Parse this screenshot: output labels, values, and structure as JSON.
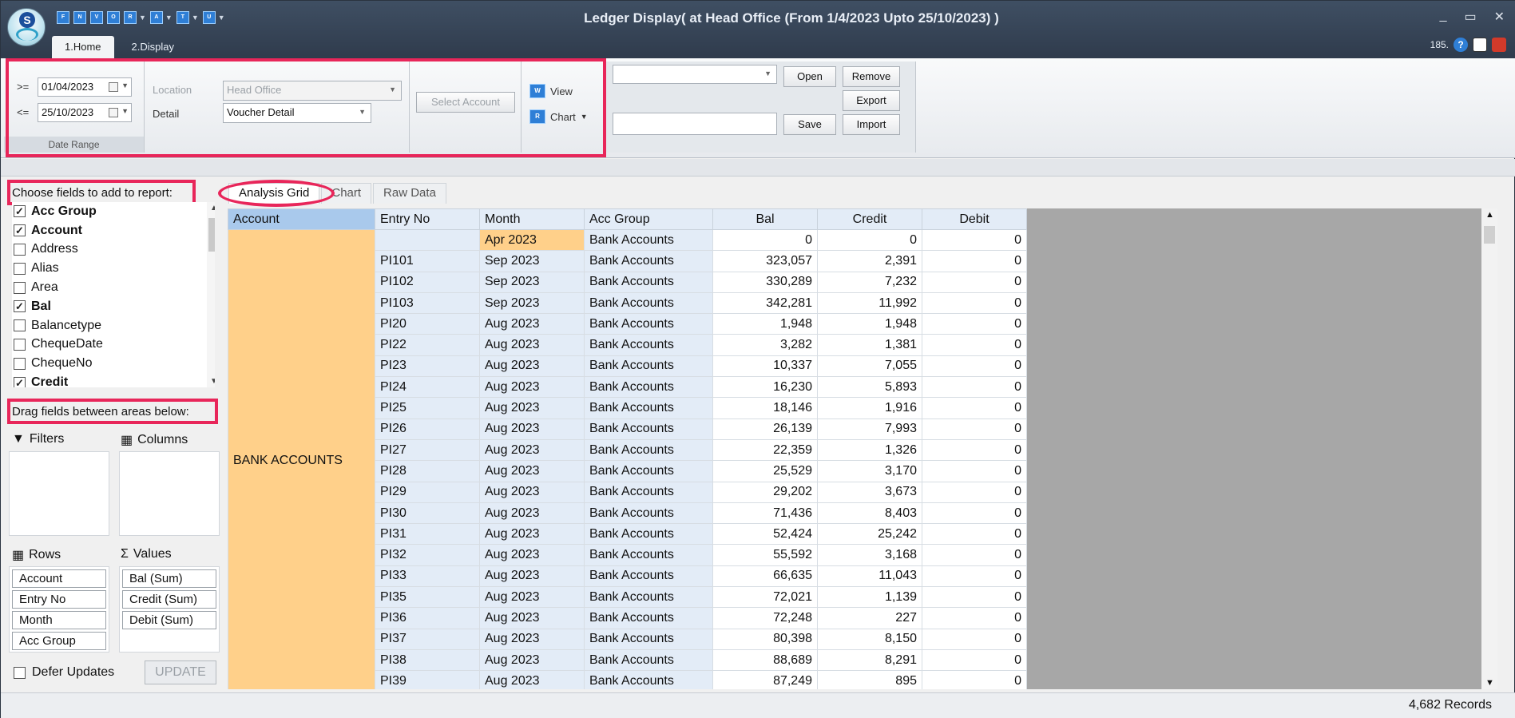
{
  "window": {
    "title": "Ledger Display( at Head Office  (From 1/4/2023 Upto 25/10/2023) )",
    "controls": [
      "_",
      "▭",
      "✕"
    ]
  },
  "quick_access": [
    "F",
    "N",
    "V",
    "O",
    "R",
    "A",
    "T",
    "U"
  ],
  "ribbon_tabs": [
    "1.Home",
    "2.Display"
  ],
  "top_right": {
    "counter": "185.",
    "help_icon": "help-icon",
    "doc_icon": "document-icon",
    "exit_icon": "exit-icon"
  },
  "ribbon": {
    "date_range": {
      "from_op": ">=",
      "from": "01/04/2023",
      "to_op": "<=",
      "to": "25/10/2023",
      "group_label": "Date Range"
    },
    "location": {
      "label": "Location",
      "value": "Head Office"
    },
    "detail": {
      "label": "Detail",
      "value": "Voucher Detail"
    },
    "select_account": "Select Account",
    "view": "View",
    "chart": "Chart",
    "open": "Open",
    "remove": "Remove",
    "export": "Export",
    "save": "Save",
    "import": "Import"
  },
  "field_chooser": {
    "title": "Choose fields to add to report:",
    "fields": [
      {
        "name": "Acc Group",
        "checked": true
      },
      {
        "name": "Account",
        "checked": true
      },
      {
        "name": "Address",
        "checked": false
      },
      {
        "name": "Alias",
        "checked": false
      },
      {
        "name": "Area",
        "checked": false
      },
      {
        "name": "Bal",
        "checked": true
      },
      {
        "name": "Balancetype",
        "checked": false
      },
      {
        "name": "ChequeDate",
        "checked": false
      },
      {
        "name": "ChequeNo",
        "checked": false
      },
      {
        "name": "Credit",
        "checked": true
      }
    ],
    "drag_title": "Drag fields between areas below:",
    "filters": "Filters",
    "columns": "Columns",
    "rows": "Rows",
    "values": "Values",
    "row_fields": [
      "Account",
      "Entry No",
      "Month",
      "Acc Group"
    ],
    "value_fields": [
      "Bal (Sum)",
      "Credit (Sum)",
      "Debit (Sum)"
    ],
    "defer": "Defer Updates",
    "update": "UPDATE"
  },
  "grid_tabs": [
    "Analysis Grid",
    "Chart",
    "Raw Data"
  ],
  "grid": {
    "headers": [
      "Account",
      "Entry No",
      "Month",
      "Acc Group",
      "Bal",
      "Credit",
      "Debit"
    ],
    "account": "BANK ACCOUNTS",
    "rows": [
      [
        "",
        "Apr 2023",
        "Bank Accounts",
        "0",
        "0",
        "0"
      ],
      [
        "PI101",
        "Sep 2023",
        "Bank Accounts",
        "323,057",
        "2,391",
        "0"
      ],
      [
        "PI102",
        "Sep 2023",
        "Bank Accounts",
        "330,289",
        "7,232",
        "0"
      ],
      [
        "PI103",
        "Sep 2023",
        "Bank Accounts",
        "342,281",
        "11,992",
        "0"
      ],
      [
        "PI20",
        "Aug 2023",
        "Bank Accounts",
        "1,948",
        "1,948",
        "0"
      ],
      [
        "PI22",
        "Aug 2023",
        "Bank Accounts",
        "3,282",
        "1,381",
        "0"
      ],
      [
        "PI23",
        "Aug 2023",
        "Bank Accounts",
        "10,337",
        "7,055",
        "0"
      ],
      [
        "PI24",
        "Aug 2023",
        "Bank Accounts",
        "16,230",
        "5,893",
        "0"
      ],
      [
        "PI25",
        "Aug 2023",
        "Bank Accounts",
        "18,146",
        "1,916",
        "0"
      ],
      [
        "PI26",
        "Aug 2023",
        "Bank Accounts",
        "26,139",
        "7,993",
        "0"
      ],
      [
        "PI27",
        "Aug 2023",
        "Bank Accounts",
        "22,359",
        "1,326",
        "0"
      ],
      [
        "PI28",
        "Aug 2023",
        "Bank Accounts",
        "25,529",
        "3,170",
        "0"
      ],
      [
        "PI29",
        "Aug 2023",
        "Bank Accounts",
        "29,202",
        "3,673",
        "0"
      ],
      [
        "PI30",
        "Aug 2023",
        "Bank Accounts",
        "71,436",
        "8,403",
        "0"
      ],
      [
        "PI31",
        "Aug 2023",
        "Bank Accounts",
        "52,424",
        "25,242",
        "0"
      ],
      [
        "PI32",
        "Aug 2023",
        "Bank Accounts",
        "55,592",
        "3,168",
        "0"
      ],
      [
        "PI33",
        "Aug 2023",
        "Bank Accounts",
        "66,635",
        "11,043",
        "0"
      ],
      [
        "PI35",
        "Aug 2023",
        "Bank Accounts",
        "72,021",
        "1,139",
        "0"
      ],
      [
        "PI36",
        "Aug 2023",
        "Bank Accounts",
        "72,248",
        "227",
        "0"
      ],
      [
        "PI37",
        "Aug 2023",
        "Bank Accounts",
        "80,398",
        "8,150",
        "0"
      ],
      [
        "PI38",
        "Aug 2023",
        "Bank Accounts",
        "88,689",
        "8,291",
        "0"
      ],
      [
        "PI39",
        "Aug 2023",
        "Bank Accounts",
        "87,249",
        "895",
        "0"
      ]
    ]
  },
  "status": {
    "records": "4,682 Records"
  },
  "colors": {
    "highlight": "#ffd08a",
    "key_cell": "#e3ecf7",
    "annotation": "#e8265a"
  }
}
